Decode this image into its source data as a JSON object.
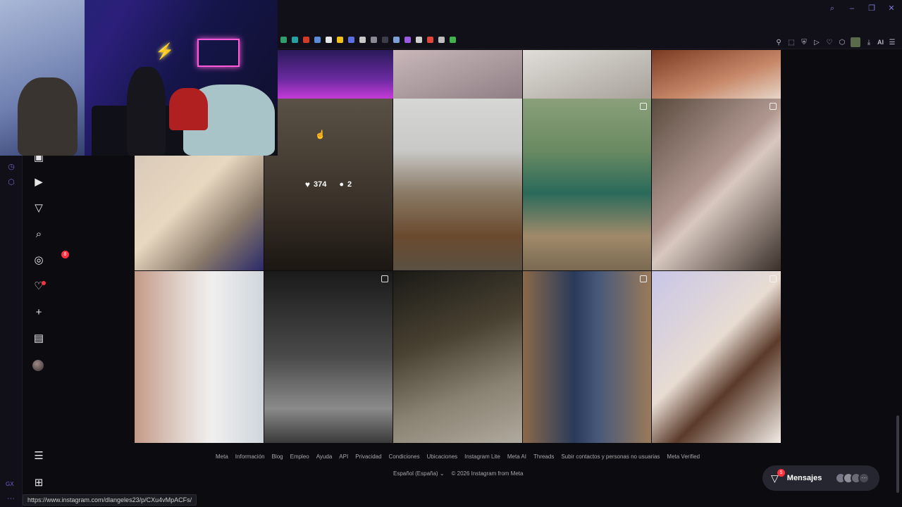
{
  "browser": {
    "status_url": "https://www.instagram.com/dlangeles23/p/CXu4vMpACFs/",
    "gx_label": "GX",
    "ai_label": "AI",
    "accent_color": "#6a63c9"
  },
  "sidebar": {
    "items": [
      {
        "name": "reels",
        "icon": "reels-icon"
      },
      {
        "name": "notifications",
        "icon": "filter-icon",
        "badge": "8"
      },
      {
        "name": "search",
        "icon": "search-icon"
      },
      {
        "name": "explore",
        "icon": "compass-icon"
      },
      {
        "name": "activity",
        "icon": "heart-icon"
      },
      {
        "name": "create",
        "icon": "plus-icon"
      },
      {
        "name": "insights",
        "icon": "chart-icon"
      },
      {
        "name": "profile",
        "icon": "avatar-icon"
      },
      {
        "name": "more",
        "icon": "menu-icon"
      },
      {
        "name": "apps",
        "icon": "grid-apps-icon"
      }
    ]
  },
  "post_hover": {
    "likes": "374",
    "comments": "2"
  },
  "footer": {
    "links": [
      "Meta",
      "Información",
      "Blog",
      "Empleo",
      "Ayuda",
      "API",
      "Privacidad",
      "Condiciones",
      "Ubicaciones",
      "Instagram Lite",
      "Meta AI",
      "Threads",
      "Subir contactos y personas no usuarias",
      "Meta Verified"
    ],
    "language": "Español (España)",
    "copyright": "© 2026 Instagram from Meta"
  },
  "messages": {
    "label": "Mensajes",
    "badge": "5",
    "more": "···"
  }
}
